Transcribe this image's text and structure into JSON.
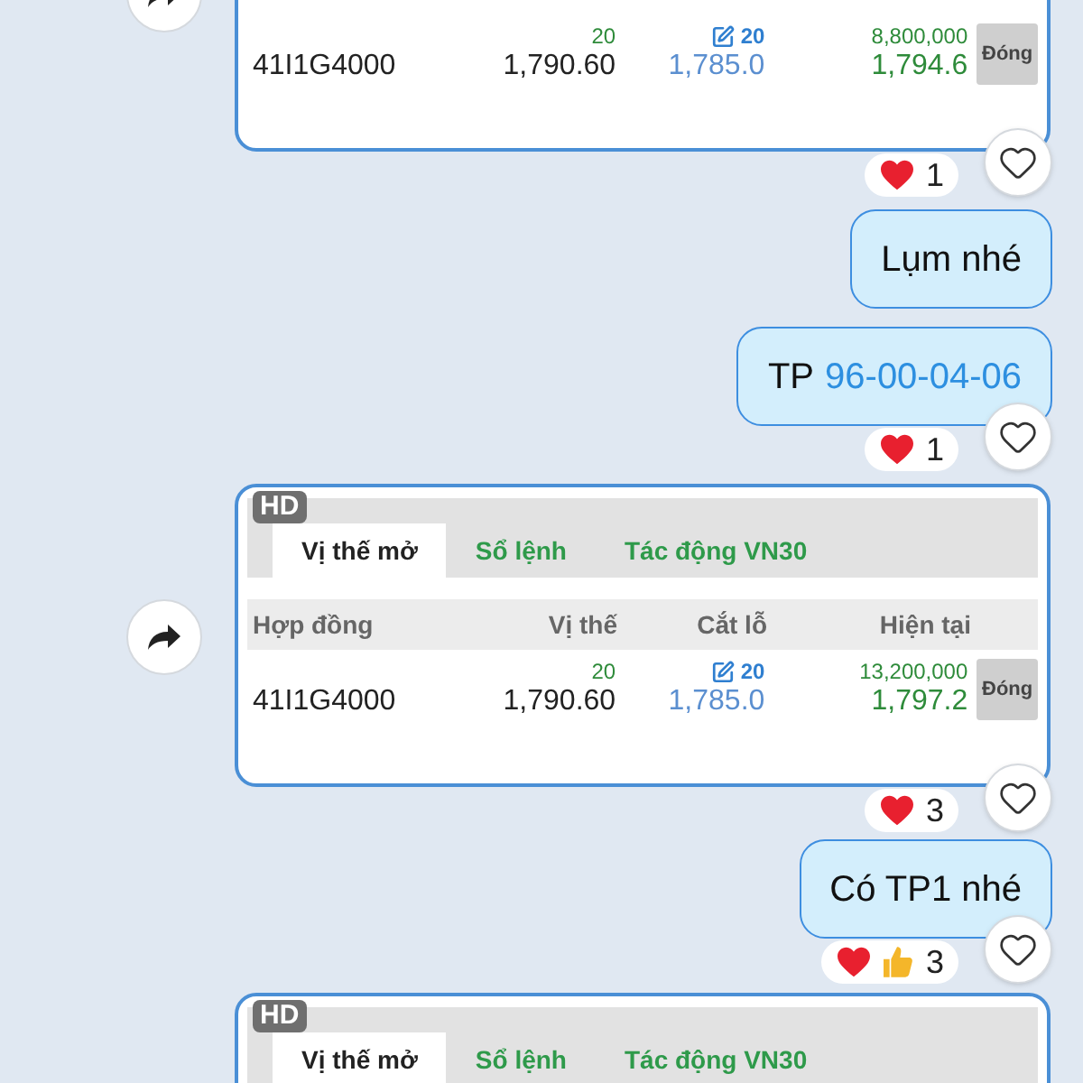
{
  "messages": [
    {
      "kind": "card",
      "forward": true,
      "rows": [
        {
          "contract": "41I1G4000",
          "position_qty": "20",
          "position_price": "1,790.60",
          "stop_qty": "20",
          "stop_price": "1,785.0",
          "current_volume": "8,800,000",
          "current_price": "1,794.6",
          "action": "Đóng"
        }
      ],
      "reactions": [
        {
          "kind": "heart"
        }
      ],
      "reaction_count": "1"
    },
    {
      "kind": "text",
      "parts": [
        {
          "kind": "plain",
          "text": "Lụm nhé"
        }
      ]
    },
    {
      "kind": "text",
      "parts": [
        {
          "kind": "plain",
          "text": "TP"
        },
        {
          "kind": "link",
          "text": "96-00-04-06"
        }
      ],
      "reactions": [
        {
          "kind": "heart"
        }
      ],
      "reaction_count": "1"
    },
    {
      "kind": "card",
      "forward": true,
      "badge": "HD",
      "tabs": [
        {
          "label": "Vị thế mở",
          "selected": true
        },
        {
          "label": "Sổ lệnh",
          "selected": false
        },
        {
          "label": "Tác động VN30",
          "selected": false
        }
      ],
      "columns": [
        "Hợp đồng",
        "Vị thế",
        "Cắt lỗ",
        "Hiện tại"
      ],
      "rows": [
        {
          "contract": "41I1G4000",
          "position_qty": "20",
          "position_price": "1,790.60",
          "stop_qty": "20",
          "stop_price": "1,785.0",
          "current_volume": "13,200,000",
          "current_price": "1,797.2",
          "action": "Đóng"
        }
      ],
      "reactions": [
        {
          "kind": "heart"
        }
      ],
      "reaction_count": "3"
    },
    {
      "kind": "text",
      "parts": [
        {
          "kind": "plain",
          "text": "Có TP1 nhé"
        }
      ],
      "reactions": [
        {
          "kind": "heart"
        },
        {
          "kind": "thumbs_up"
        }
      ],
      "reaction_count": "3"
    },
    {
      "kind": "card",
      "badge": "HD",
      "tabs": [
        {
          "label": "Vị thế mở",
          "selected": true
        },
        {
          "label": "Sổ lệnh",
          "selected": false
        },
        {
          "label": "Tác động VN30",
          "selected": false
        }
      ]
    }
  ]
}
